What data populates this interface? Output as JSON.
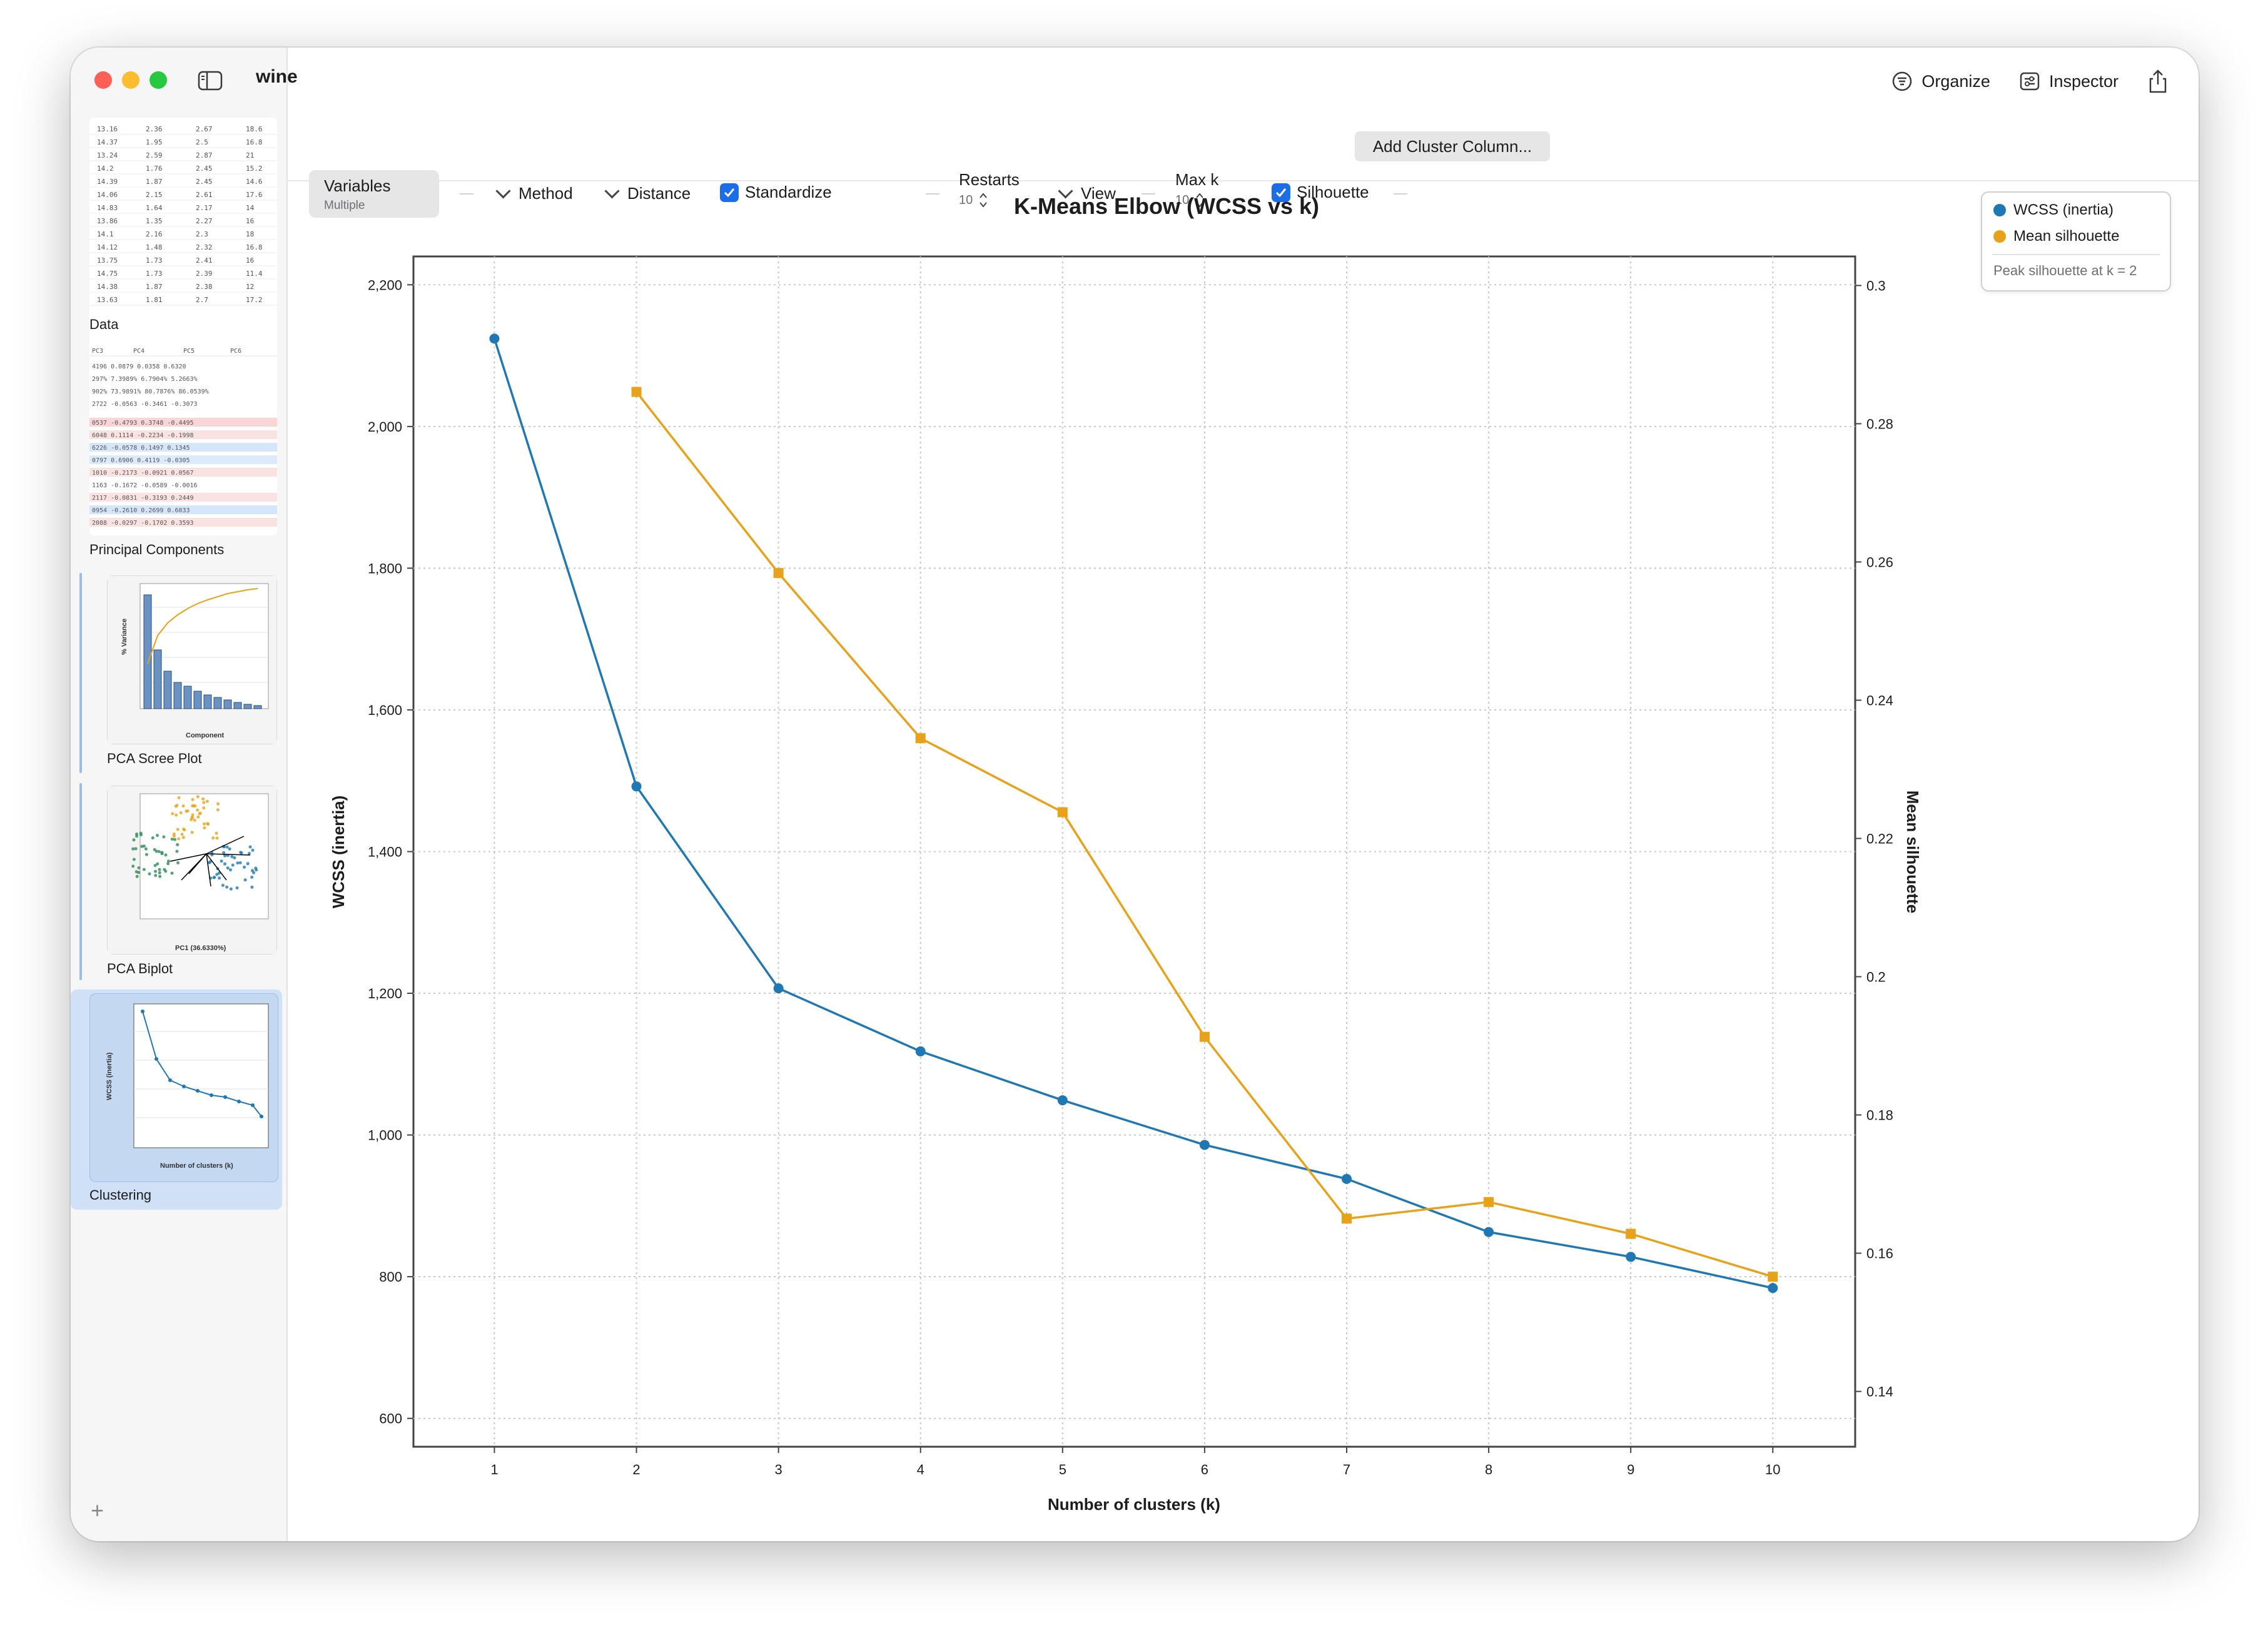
{
  "window": {
    "title": "wine"
  },
  "header_actions": {
    "organize": "Organize",
    "inspector": "Inspector"
  },
  "sidebar": {
    "items": [
      {
        "label": "Data"
      },
      {
        "label": "Principal Components"
      },
      {
        "label": "PCA Scree Plot"
      },
      {
        "label": "PCA Biplot"
      },
      {
        "label": "Clustering"
      }
    ],
    "data_preview_rows": [
      [
        "13.16",
        "2.36",
        "2.67",
        "18.6"
      ],
      [
        "14.37",
        "1.95",
        "2.5",
        "16.8"
      ],
      [
        "13.24",
        "2.59",
        "2.87",
        "21"
      ],
      [
        "14.2",
        "1.76",
        "2.45",
        "15.2"
      ],
      [
        "14.39",
        "1.87",
        "2.45",
        "14.6"
      ],
      [
        "14.06",
        "2.15",
        "2.61",
        "17.6"
      ],
      [
        "14.83",
        "1.64",
        "2.17",
        "14"
      ],
      [
        "13.86",
        "1.35",
        "2.27",
        "16"
      ],
      [
        "14.1",
        "2.16",
        "2.3",
        "18"
      ],
      [
        "14.12",
        "1.48",
        "2.32",
        "16.8"
      ],
      [
        "13.75",
        "1.73",
        "2.41",
        "16"
      ],
      [
        "14.75",
        "1.73",
        "2.39",
        "11.4"
      ],
      [
        "14.38",
        "1.87",
        "2.38",
        "12"
      ],
      [
        "13.63",
        "1.81",
        "2.7",
        "17.2"
      ]
    ]
  },
  "toolbar": {
    "variables_label": "Variables",
    "variables_sub": "Multiple",
    "method_label": "Method",
    "distance_label": "Distance",
    "standardize_label": "Standardize",
    "restarts_label": "Restarts",
    "restarts_value": "10",
    "view_label": "View",
    "maxk_label": "Max k",
    "maxk_value": "10",
    "silhouette_label": "Silhouette",
    "add_cluster_label": "Add Cluster Column..."
  },
  "legend": {
    "wcss": "WCSS (inertia)",
    "silhouette": "Mean silhouette",
    "note": "Peak silhouette at k = 2"
  },
  "colors": {
    "wcss": "#1f77b4",
    "silhouette": "#e8a21a",
    "accent": "#1a6fe8"
  },
  "chart_data": {
    "type": "line",
    "title": "K-Means Elbow (WCSS vs k)",
    "xlabel": "Number of clusters (k)",
    "ylabel": "WCSS (inertia)",
    "y2label": "Mean silhouette",
    "x": [
      1,
      2,
      3,
      4,
      5,
      6,
      7,
      8,
      9,
      10
    ],
    "ylim": [
      560,
      2240
    ],
    "y2lim": [
      0.132,
      0.3042
    ],
    "yticks": [
      600,
      800,
      1000,
      1200,
      1400,
      1600,
      1800,
      2000,
      2200
    ],
    "ytick_labels": [
      "600",
      "800",
      "1,000",
      "1,200",
      "1,400",
      "1,600",
      "1,800",
      "2,000",
      "2,200"
    ],
    "y2ticks": [
      0.14,
      0.16,
      0.18,
      0.2,
      0.22,
      0.24,
      0.26,
      0.28,
      0.3
    ],
    "y2tick_labels": [
      "0.14",
      "0.16",
      "0.18",
      "0.2",
      "0.22",
      "0.24",
      "0.26",
      "0.28",
      "0.3"
    ],
    "grid": true,
    "legend_position": "top-right",
    "series": [
      {
        "name": "WCSS (inertia)",
        "axis": "left",
        "marker": "circle",
        "x": [
          1,
          2,
          3,
          4,
          5,
          6,
          7,
          8,
          9,
          10
        ],
        "values": [
          2124,
          1492,
          1207,
          1118,
          1049,
          986,
          938,
          863,
          828,
          784
        ]
      },
      {
        "name": "Mean silhouette",
        "axis": "right",
        "marker": "square",
        "x": [
          2,
          3,
          4,
          5,
          6,
          7,
          8,
          9,
          10
        ],
        "values": [
          0.2846,
          0.2584,
          0.2345,
          0.2238,
          0.1913,
          0.165,
          0.1674,
          0.1628,
          0.1566
        ]
      }
    ]
  }
}
